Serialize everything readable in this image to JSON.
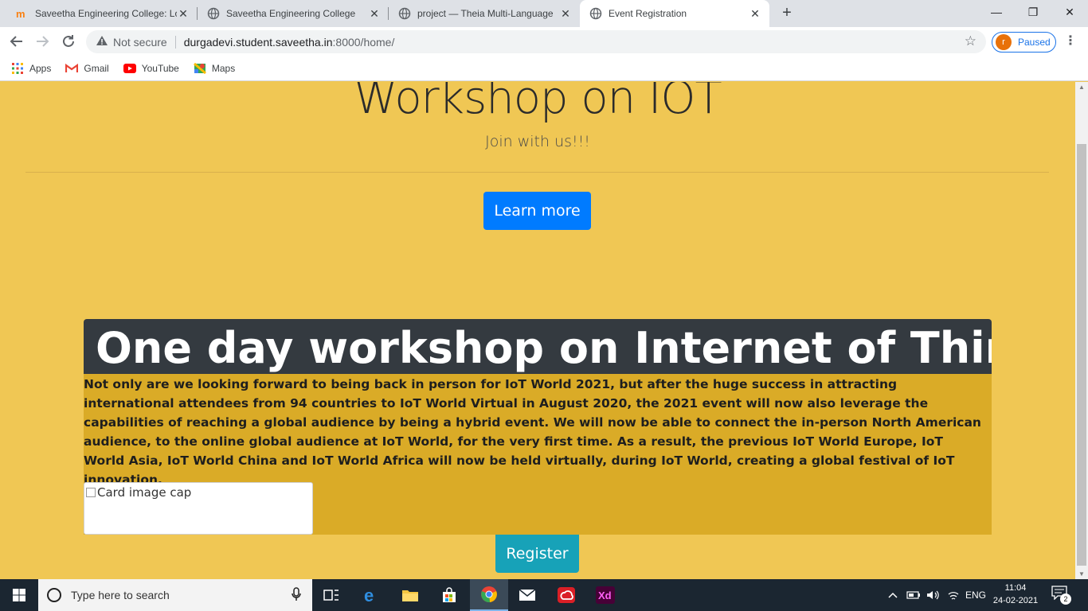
{
  "browser": {
    "tabs": [
      {
        "title": "Saveetha Engineering College: Lo",
        "active": false
      },
      {
        "title": "Saveetha Engineering College",
        "active": false
      },
      {
        "title": "project — Theia Multi-Language",
        "active": false
      },
      {
        "title": "Event Registration",
        "active": true
      }
    ],
    "new_tab_label": "+",
    "window_controls": {
      "minimize": "—",
      "maximize": "❐",
      "close": "✕"
    },
    "security_label": "Not secure",
    "url_host": "durgadevi.student.saveetha.in",
    "url_path": ":8000/home/",
    "profile_initial": "r",
    "profile_status": "Paused",
    "bookmarks": [
      {
        "label": "Apps",
        "icon": "apps-grid-icon"
      },
      {
        "label": "Gmail",
        "icon": "gmail-icon"
      },
      {
        "label": "YouTube",
        "icon": "youtube-icon"
      },
      {
        "label": "Maps",
        "icon": "maps-icon"
      }
    ]
  },
  "page": {
    "hero_title": "Workshop on IOT",
    "hero_subtitle": "Join with us!!!",
    "learn_more_label": "Learn more",
    "card_header": "One day workshop on Internet of Things",
    "card_text": "Not only are we looking forward to being back in person for IoT World 2021, but after the huge success in attracting international attendees from 94 countries to IoT World Virtual in August 2020, the 2021 event will now also leverage the capabilities of reaching a global audience by being a hybrid event. We will now be able to connect the in-person North American audience, to the online global audience at IoT World, for the very first time. As a result, the previous IoT World Europe, IoT World Asia, IoT World China and IoT World Africa will now be held virtually, during IoT World, creating a global festival of IoT innovation.",
    "card_image_alt": "Card image cap",
    "register_label": "Register",
    "colors": {
      "background": "#f0c754",
      "card_body": "#daab27",
      "card_header": "#343a40",
      "primary_button": "#007bff",
      "info_button": "#17a2b8"
    }
  },
  "taskbar": {
    "search_placeholder": "Type here to search",
    "apps": [
      "task-view-icon",
      "edge-icon",
      "file-explorer-icon",
      "store-icon",
      "chrome-icon",
      "mail-icon",
      "creative-cloud-icon",
      "adobe-xd-icon"
    ],
    "xd_label": "Xd",
    "language": "ENG",
    "time": "11:04",
    "date": "24-02-2021",
    "notification_count": "2"
  }
}
